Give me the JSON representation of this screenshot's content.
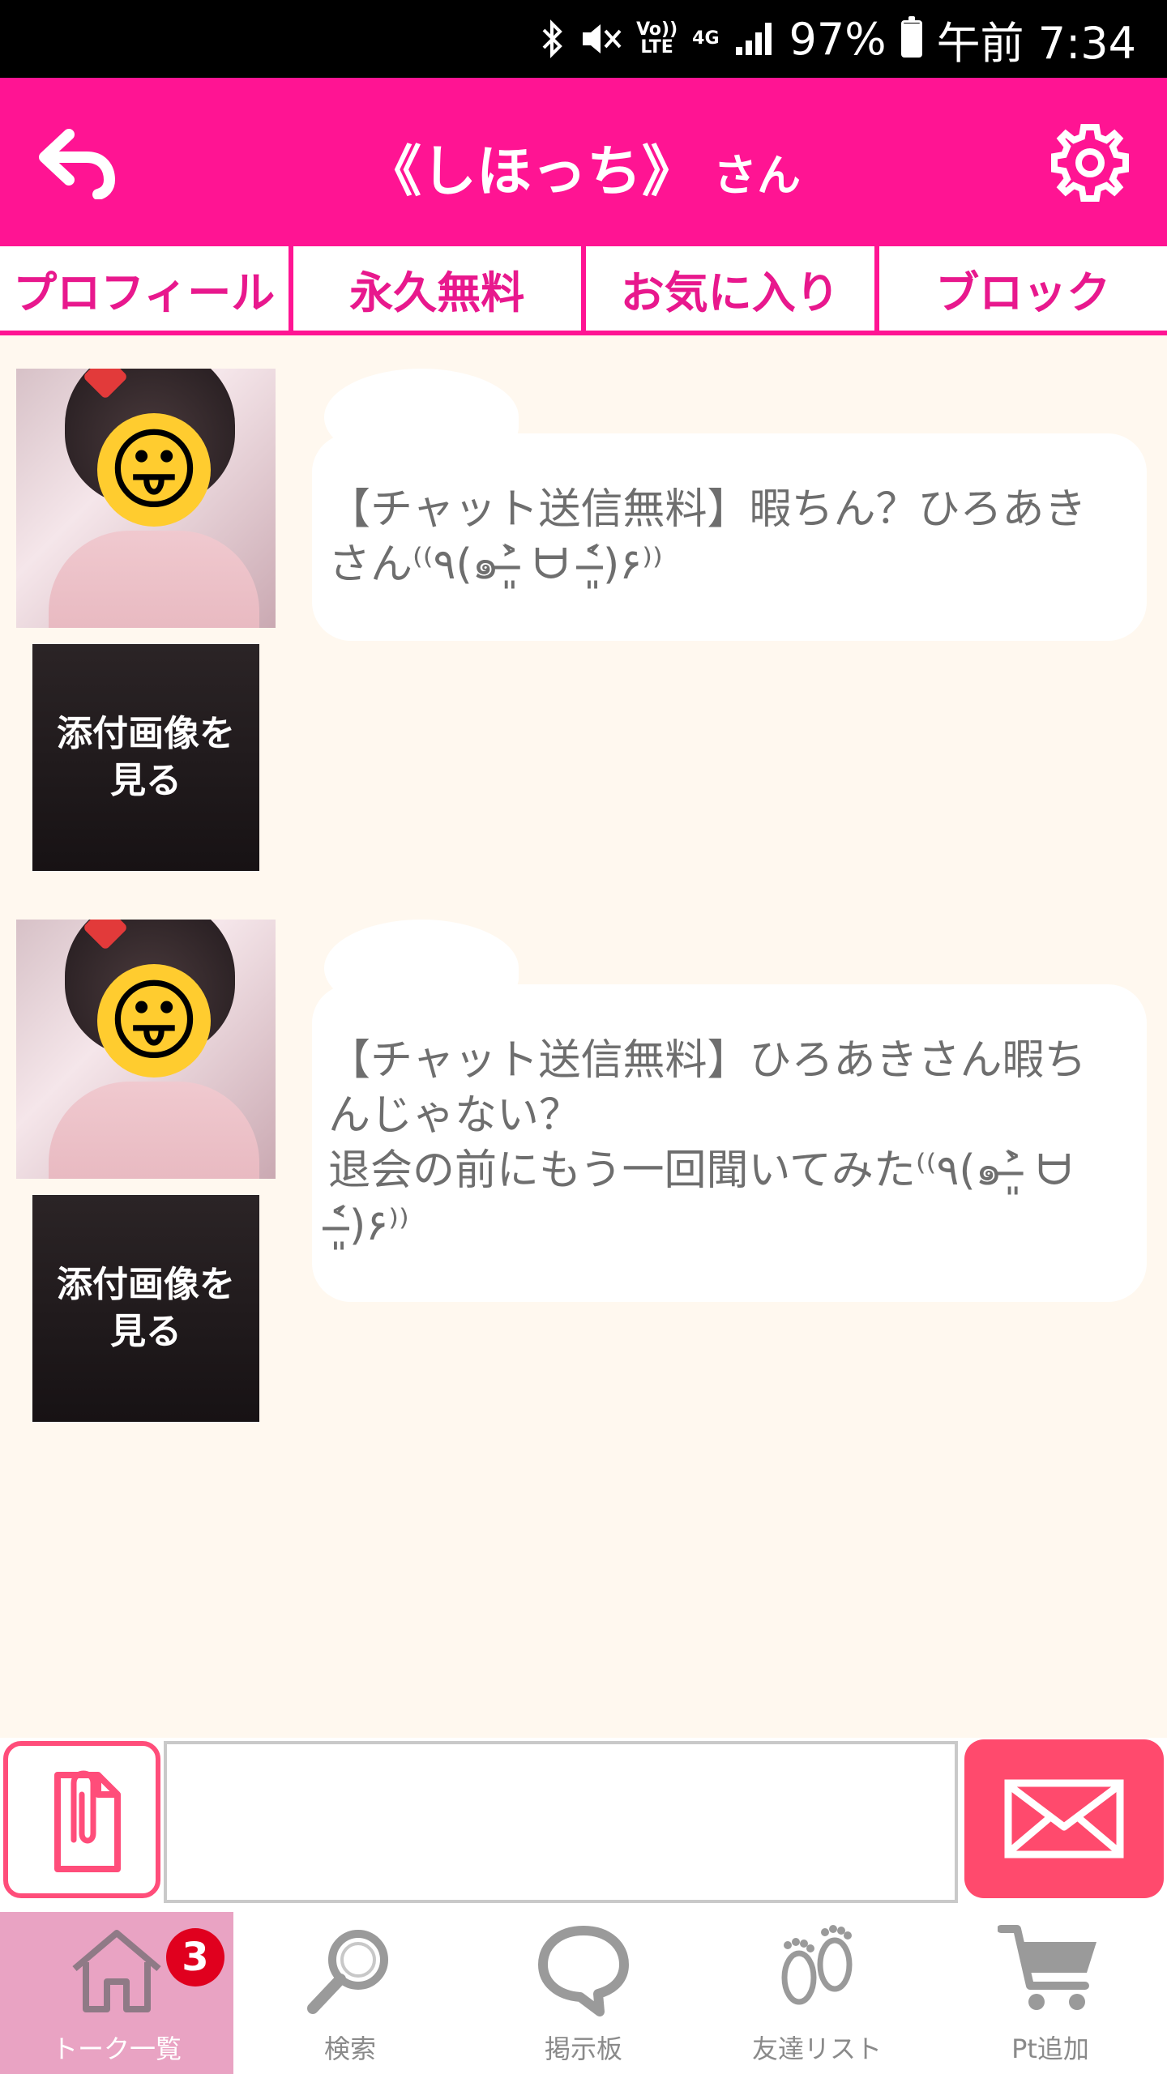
{
  "status_bar": {
    "volte": "Vo))\nLTE",
    "network": "4G",
    "battery_percent": "97%",
    "battery_level": 0.97,
    "time": "午前 7:34"
  },
  "header": {
    "title": "《しほっち》",
    "title_suffix": "さん",
    "back_icon": "back-arrow-icon",
    "settings_icon": "gear-icon",
    "background_color": "#ff1493"
  },
  "tabs": [
    {
      "label": "プロフィール"
    },
    {
      "label": "永久無料"
    },
    {
      "label": "お気に入り"
    },
    {
      "label": "ブロック"
    }
  ],
  "messages": [
    {
      "text": "【チャット送信無料】暇ちん？ひろあきさん⁽⁽٩(๑˃̶͈̀ ᗨ ˂̶͈́)۶⁾⁾",
      "attachment_label": "添付画像を見る"
    },
    {
      "text": "【チャット送信無料】ひろあきさん暇ちんじゃない？\n退会の前にもう一回聞いてみた⁽⁽٩(๑˃̶͈̀ ᗨ ˂̶͈́)۶⁾⁾",
      "attachment_label": "添付画像を見る"
    }
  ],
  "input": {
    "value": "",
    "attach_icon": "attach-file-icon",
    "send_icon": "envelope-icon",
    "accent_color": "#ff4a6d"
  },
  "bottom_nav": [
    {
      "label": "トーク一覧",
      "icon": "home-icon",
      "badge": "3",
      "active": true
    },
    {
      "label": "検索",
      "icon": "search-icon"
    },
    {
      "label": "掲示板",
      "icon": "speech-bubble-icon"
    },
    {
      "label": "友達リスト",
      "icon": "footprints-icon"
    },
    {
      "label": "Pt追加",
      "icon": "cart-icon"
    }
  ]
}
